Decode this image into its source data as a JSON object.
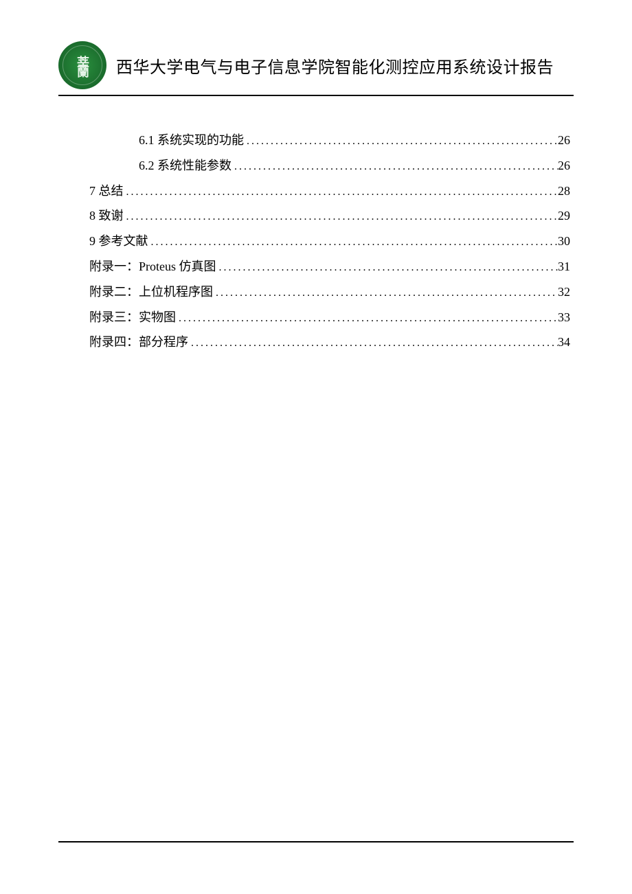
{
  "header": {
    "logo_text": "莘蘭",
    "title": "西华大学电气与电子信息学院智能化测控应用系统设计报告"
  },
  "toc": [
    {
      "label": "6.1 系统实现的功能",
      "page": "26",
      "indent": true
    },
    {
      "label": "6.2 系统性能参数",
      "page": "26",
      "indent": true
    },
    {
      "label": "7 总结",
      "page": "28",
      "indent": false
    },
    {
      "label": "8 致谢",
      "page": "29",
      "indent": false
    },
    {
      "label": "9 参考文献",
      "page": "30",
      "indent": false
    },
    {
      "label": "附录一：Proteus 仿真图",
      "page": "31",
      "indent": false
    },
    {
      "label": "附录二：上位机程序图",
      "page": "32",
      "indent": false
    },
    {
      "label": "附录三：实物图",
      "page": "33",
      "indent": false
    },
    {
      "label": "附录四：部分程序",
      "page": "34",
      "indent": false
    }
  ]
}
